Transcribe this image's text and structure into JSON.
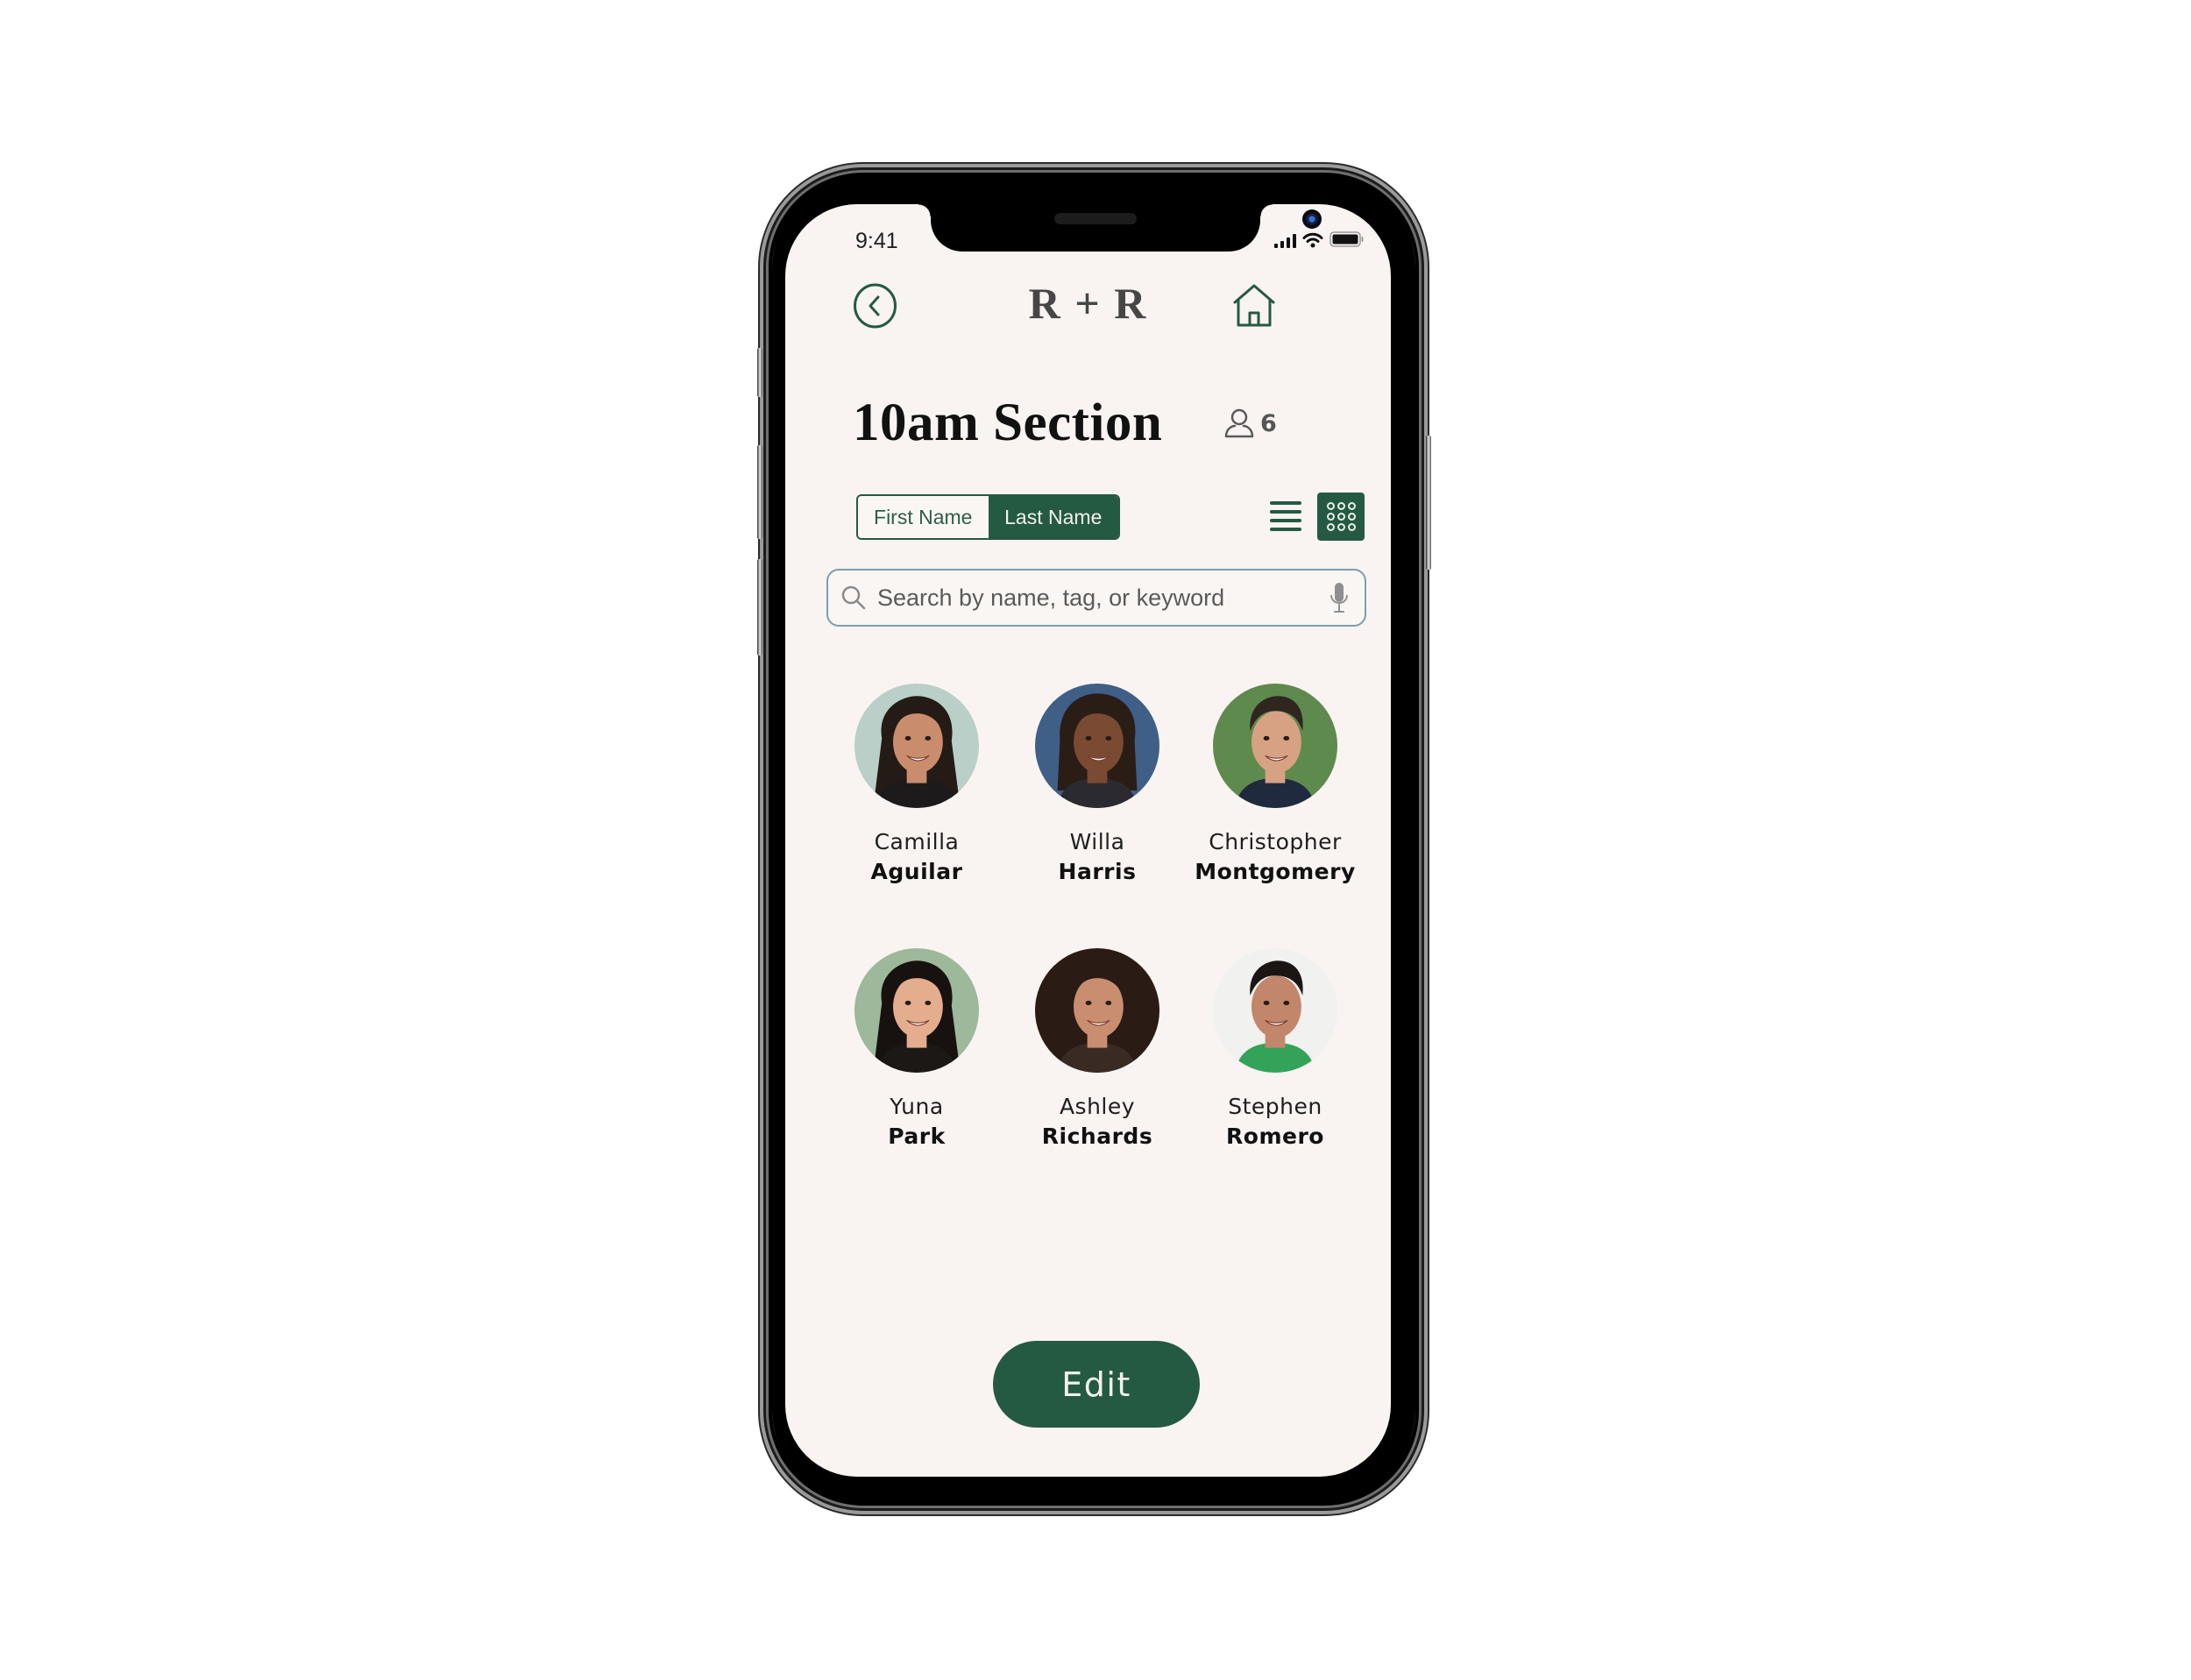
{
  "status_bar": {
    "time": "9:41",
    "signal_icon": "cellular-signal-icon",
    "wifi_icon": "wifi-icon",
    "battery_icon": "battery-icon"
  },
  "header": {
    "back_icon": "chevron-left-circle-icon",
    "logo": "R + R",
    "home_icon": "home-icon"
  },
  "section": {
    "title": "10am Section",
    "count_icon": "person-icon",
    "count": "6"
  },
  "name_order_toggle": {
    "options": [
      {
        "label": "First Name",
        "selected": false
      },
      {
        "label": "Last Name",
        "selected": true
      }
    ]
  },
  "view_toggle": {
    "list_icon": "list-view-icon",
    "grid_icon": "grid-view-icon",
    "selected": "grid"
  },
  "search": {
    "placeholder": "Search by name, tag, or keyword",
    "value": "",
    "search_icon": "magnifier-icon",
    "mic_icon": "microphone-icon"
  },
  "students": [
    {
      "first": "Camilla",
      "last": "Aguilar",
      "avatar": {
        "bg": "#b9cfc8",
        "hair": "#241a16",
        "skin": "#c98d6e",
        "shirt": "#1d1a1c",
        "hair_style": "long"
      }
    },
    {
      "first": "Willa",
      "last": "Harris",
      "avatar": {
        "bg": "#3f5f87",
        "hair": "#2a1d16",
        "skin": "#7a4a33",
        "shirt": "#2b2a30",
        "hair_style": "braids"
      }
    },
    {
      "first": "Christopher",
      "last": "Montgomery",
      "avatar": {
        "bg": "#5f8a4d",
        "hair": "#2f2620",
        "skin": "#d7a184",
        "shirt": "#1f2a3f",
        "hair_style": "short"
      }
    },
    {
      "first": "Yuna",
      "last": "Park",
      "avatar": {
        "bg": "#9db89a",
        "hair": "#17120f",
        "skin": "#e3ad8e",
        "shirt": "#1c1816",
        "hair_style": "long"
      }
    },
    {
      "first": "Ashley",
      "last": "Richards",
      "avatar": {
        "bg": "#2a1b15",
        "hair": "#2a1b15",
        "skin": "#c98e70",
        "shirt": "#3a2a24",
        "hair_style": "curly"
      }
    },
    {
      "first": "Stephen",
      "last": "Romero",
      "avatar": {
        "bg": "#f1f1ef",
        "hair": "#1b1613",
        "skin": "#c2866a",
        "shirt": "#34a35a",
        "hair_style": "short"
      }
    }
  ],
  "actions": {
    "edit_label": "Edit"
  },
  "colors": {
    "accent": "#245a41",
    "screen_bg": "#f9f4f1",
    "search_border": "#7d9db4"
  }
}
